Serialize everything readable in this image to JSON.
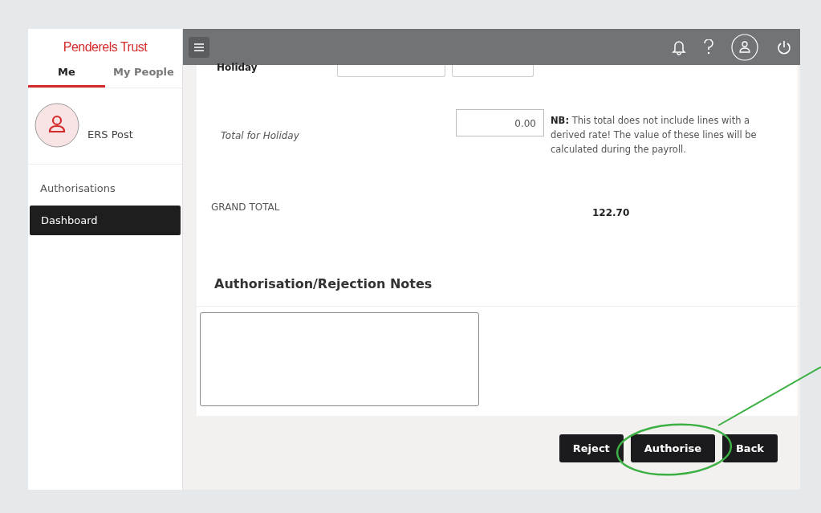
{
  "sidebar": {
    "logo": "Penderels Trust",
    "tabs": [
      {
        "label": "Me",
        "selected": true
      },
      {
        "label": "My People",
        "selected": false
      }
    ],
    "user": {
      "name": "ERS Post"
    },
    "items": [
      {
        "label": "Authorisations",
        "selected": false
      },
      {
        "label": "Dashboard",
        "selected": true
      }
    ]
  },
  "form": {
    "holiday_label": "Holiday",
    "total_label": "Total for Holiday",
    "total_value": "0.00",
    "note": "**NB:** This total does not include lines with a derived rate! The value of these lines will be calculated during the payroll.",
    "grand_total_label": "GRAND TOTAL",
    "grand_total_value": "122.70"
  },
  "notes": {
    "heading": "Authorisation/Rejection Notes"
  },
  "buttons": [
    "Reject",
    "Authorise",
    "Back"
  ]
}
